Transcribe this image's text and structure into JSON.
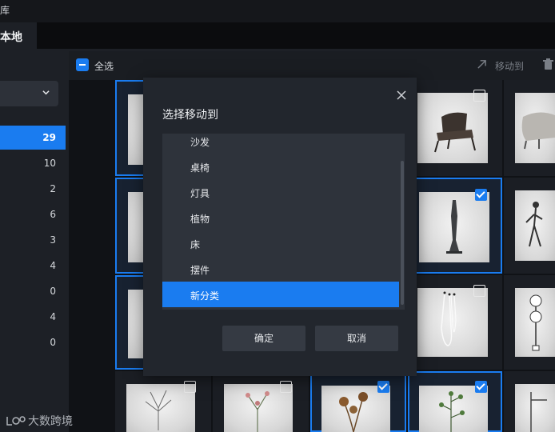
{
  "window": {
    "title_fragment": "库"
  },
  "header": {
    "title_fragment": "本地"
  },
  "sidebar": {
    "counts": [
      "29",
      "10",
      "2",
      "6",
      "3",
      "4",
      "0",
      "4",
      "0"
    ]
  },
  "toolbar": {
    "select_all_label": "全选",
    "move_label": "移动到"
  },
  "dialog": {
    "title": "选择移动到",
    "categories": [
      "沙发",
      "桌椅",
      "灯具",
      "植物",
      "床",
      "摆件",
      "新分类"
    ],
    "selected_category": "新分类",
    "confirm_label": "确定",
    "cancel_label": "取消"
  },
  "watermark": {
    "text": "大数跨境"
  },
  "colors": {
    "accent": "#1a7cf0",
    "dialog_bg": "#22262d",
    "list_bg": "#2e333b"
  }
}
